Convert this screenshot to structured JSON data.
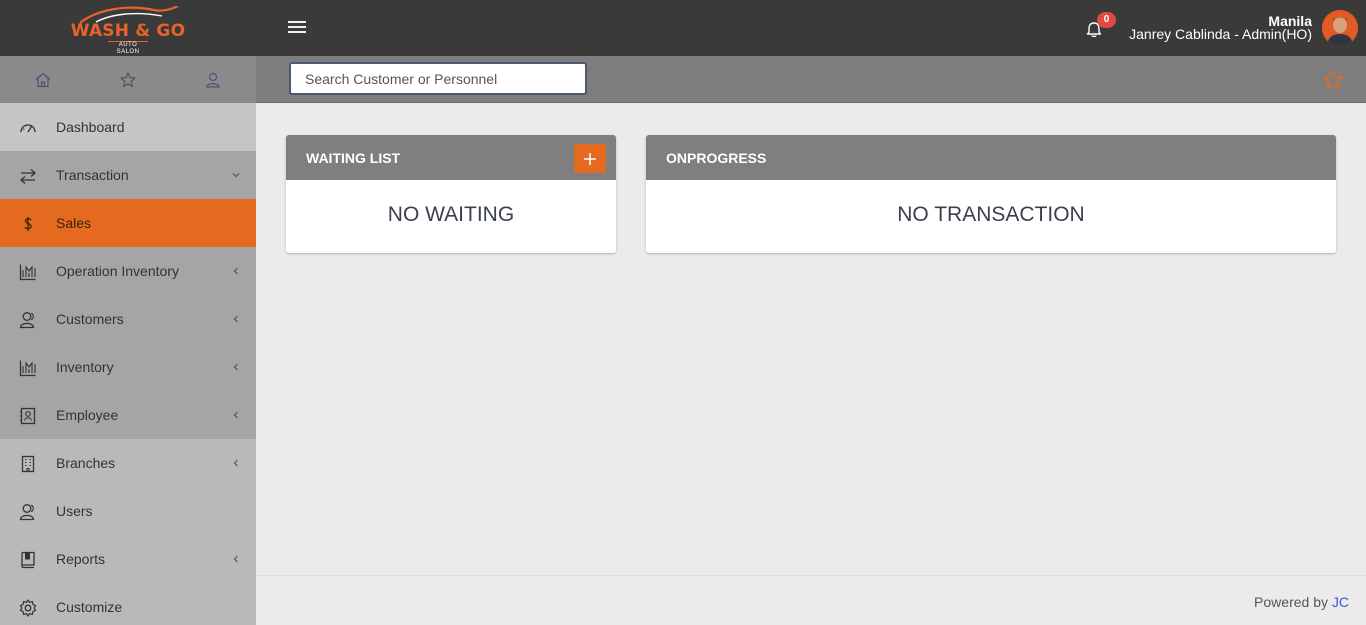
{
  "brand": {
    "logo_text": "WASH & GO",
    "logo_subtext": "AUTO SALON",
    "accent_color": "#e36a1e"
  },
  "header": {
    "notification_count": "0",
    "user_branch": "Manila",
    "user_name": "Janrey Cablinda - Admin(HO)"
  },
  "search": {
    "placeholder": "Search Customer or Personnel"
  },
  "sidebar": {
    "tabs": [
      {
        "icon": "home-icon"
      },
      {
        "icon": "star-icon"
      },
      {
        "icon": "user-icon"
      }
    ],
    "items": [
      {
        "label": "Dashboard",
        "icon": "dashboard-icon"
      },
      {
        "label": "Transaction",
        "icon": "transfer-icon"
      },
      {
        "label": "Sales",
        "icon": "dollar-icon"
      },
      {
        "label": "Operation Inventory",
        "icon": "chart-icon"
      },
      {
        "label": "Customers",
        "icon": "users-icon"
      },
      {
        "label": "Inventory",
        "icon": "chart-icon"
      },
      {
        "label": "Employee",
        "icon": "contact-card-icon"
      },
      {
        "label": "Branches",
        "icon": "building-icon"
      },
      {
        "label": "Users",
        "icon": "users-icon"
      },
      {
        "label": "Reports",
        "icon": "book-icon"
      },
      {
        "label": "Customize",
        "icon": "gear-icon"
      }
    ]
  },
  "main": {
    "waiting_list": {
      "title": "WAITING LIST",
      "empty_text": "NO WAITING"
    },
    "onprogress": {
      "title": "ONPROGRESS",
      "empty_text": "NO TRANSACTION"
    }
  },
  "footer": {
    "powered_by": "Powered by",
    "link": "JC"
  }
}
